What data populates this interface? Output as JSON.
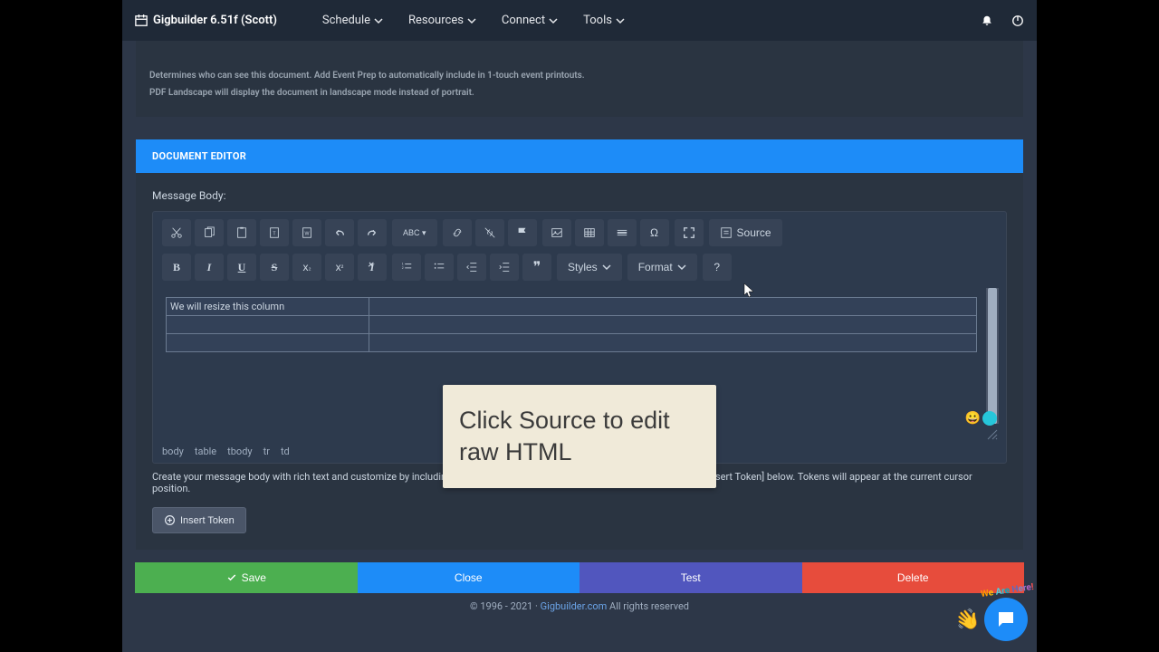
{
  "app": {
    "title": "Gigbuilder 6.51f (Scott)"
  },
  "nav": {
    "items": [
      "Schedule",
      "Resources",
      "Connect",
      "Tools"
    ]
  },
  "upper": {
    "help1": "Determines who can see this document. Add Event Prep to automatically include in 1-touch event printouts.",
    "help2": "PDF Landscape will display the document in landscape mode instead of portrait."
  },
  "section": {
    "title": "DOCUMENT EDITOR"
  },
  "editor": {
    "label": "Message Body:",
    "source": "Source",
    "styles": "Styles",
    "format": "Format",
    "table_cell": "We will resize this column",
    "path": [
      "body",
      "table",
      "tbody",
      "tr",
      "td"
    ]
  },
  "desc_full": "Create your message body with rich text and customize by including tokens which will be replaced by real information. Select [Insert Token] below. Tokens will appear at the current cursor position.",
  "insert_token": "Insert Token",
  "actions": {
    "save": "Save",
    "close": "Close",
    "test": "Test",
    "delete": "Delete"
  },
  "footer": {
    "copyright": "© 1996 - 2021 ·",
    "link": "Gigbuilder.com",
    "rest": "All rights reserved"
  },
  "tooltip": "Click Source to edit raw HTML",
  "badge": {
    "text": "We Are Here!"
  }
}
